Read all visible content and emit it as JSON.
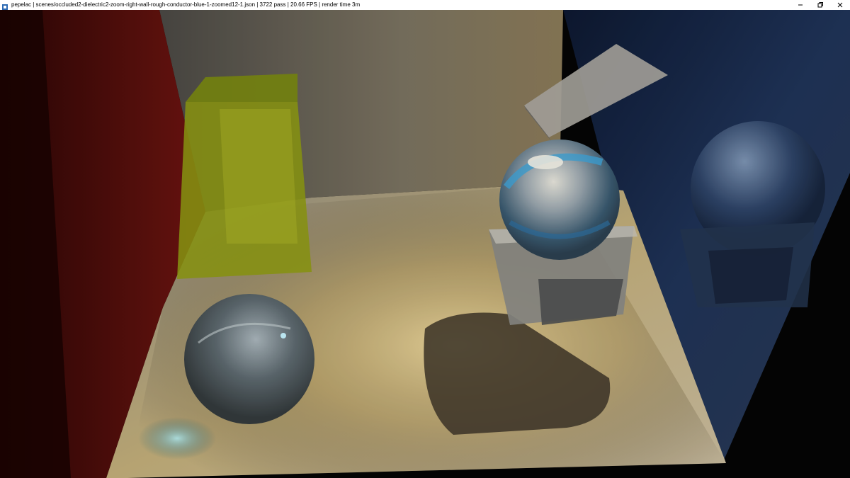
{
  "window": {
    "title": "pepelac | scenes/occluded2-dielectric2-zoom-right-wall-rough-conductor-blue-1-zoomed12-1.json  |  3722 pass  | 20.66 FPS | render time 3m",
    "icons": {
      "app": "app-icon",
      "minimize": "minimize-icon",
      "restore": "restore-icon",
      "close": "close-icon"
    }
  },
  "scene": {
    "description_icons": [
      "red-left-wall",
      "yellow-glass-block",
      "glass-sphere-small",
      "glass-sphere-on-cube",
      "frosted-glass-plate",
      "rough-conductor-blue-wall"
    ],
    "colors": {
      "left_wall": "#5a0e0c",
      "back_wall": "#6a6558",
      "floor": "#b5a67a",
      "right_wall": "#1a2a4a",
      "yellow_block": "#9aa50f",
      "light": "#fff2b0"
    }
  }
}
